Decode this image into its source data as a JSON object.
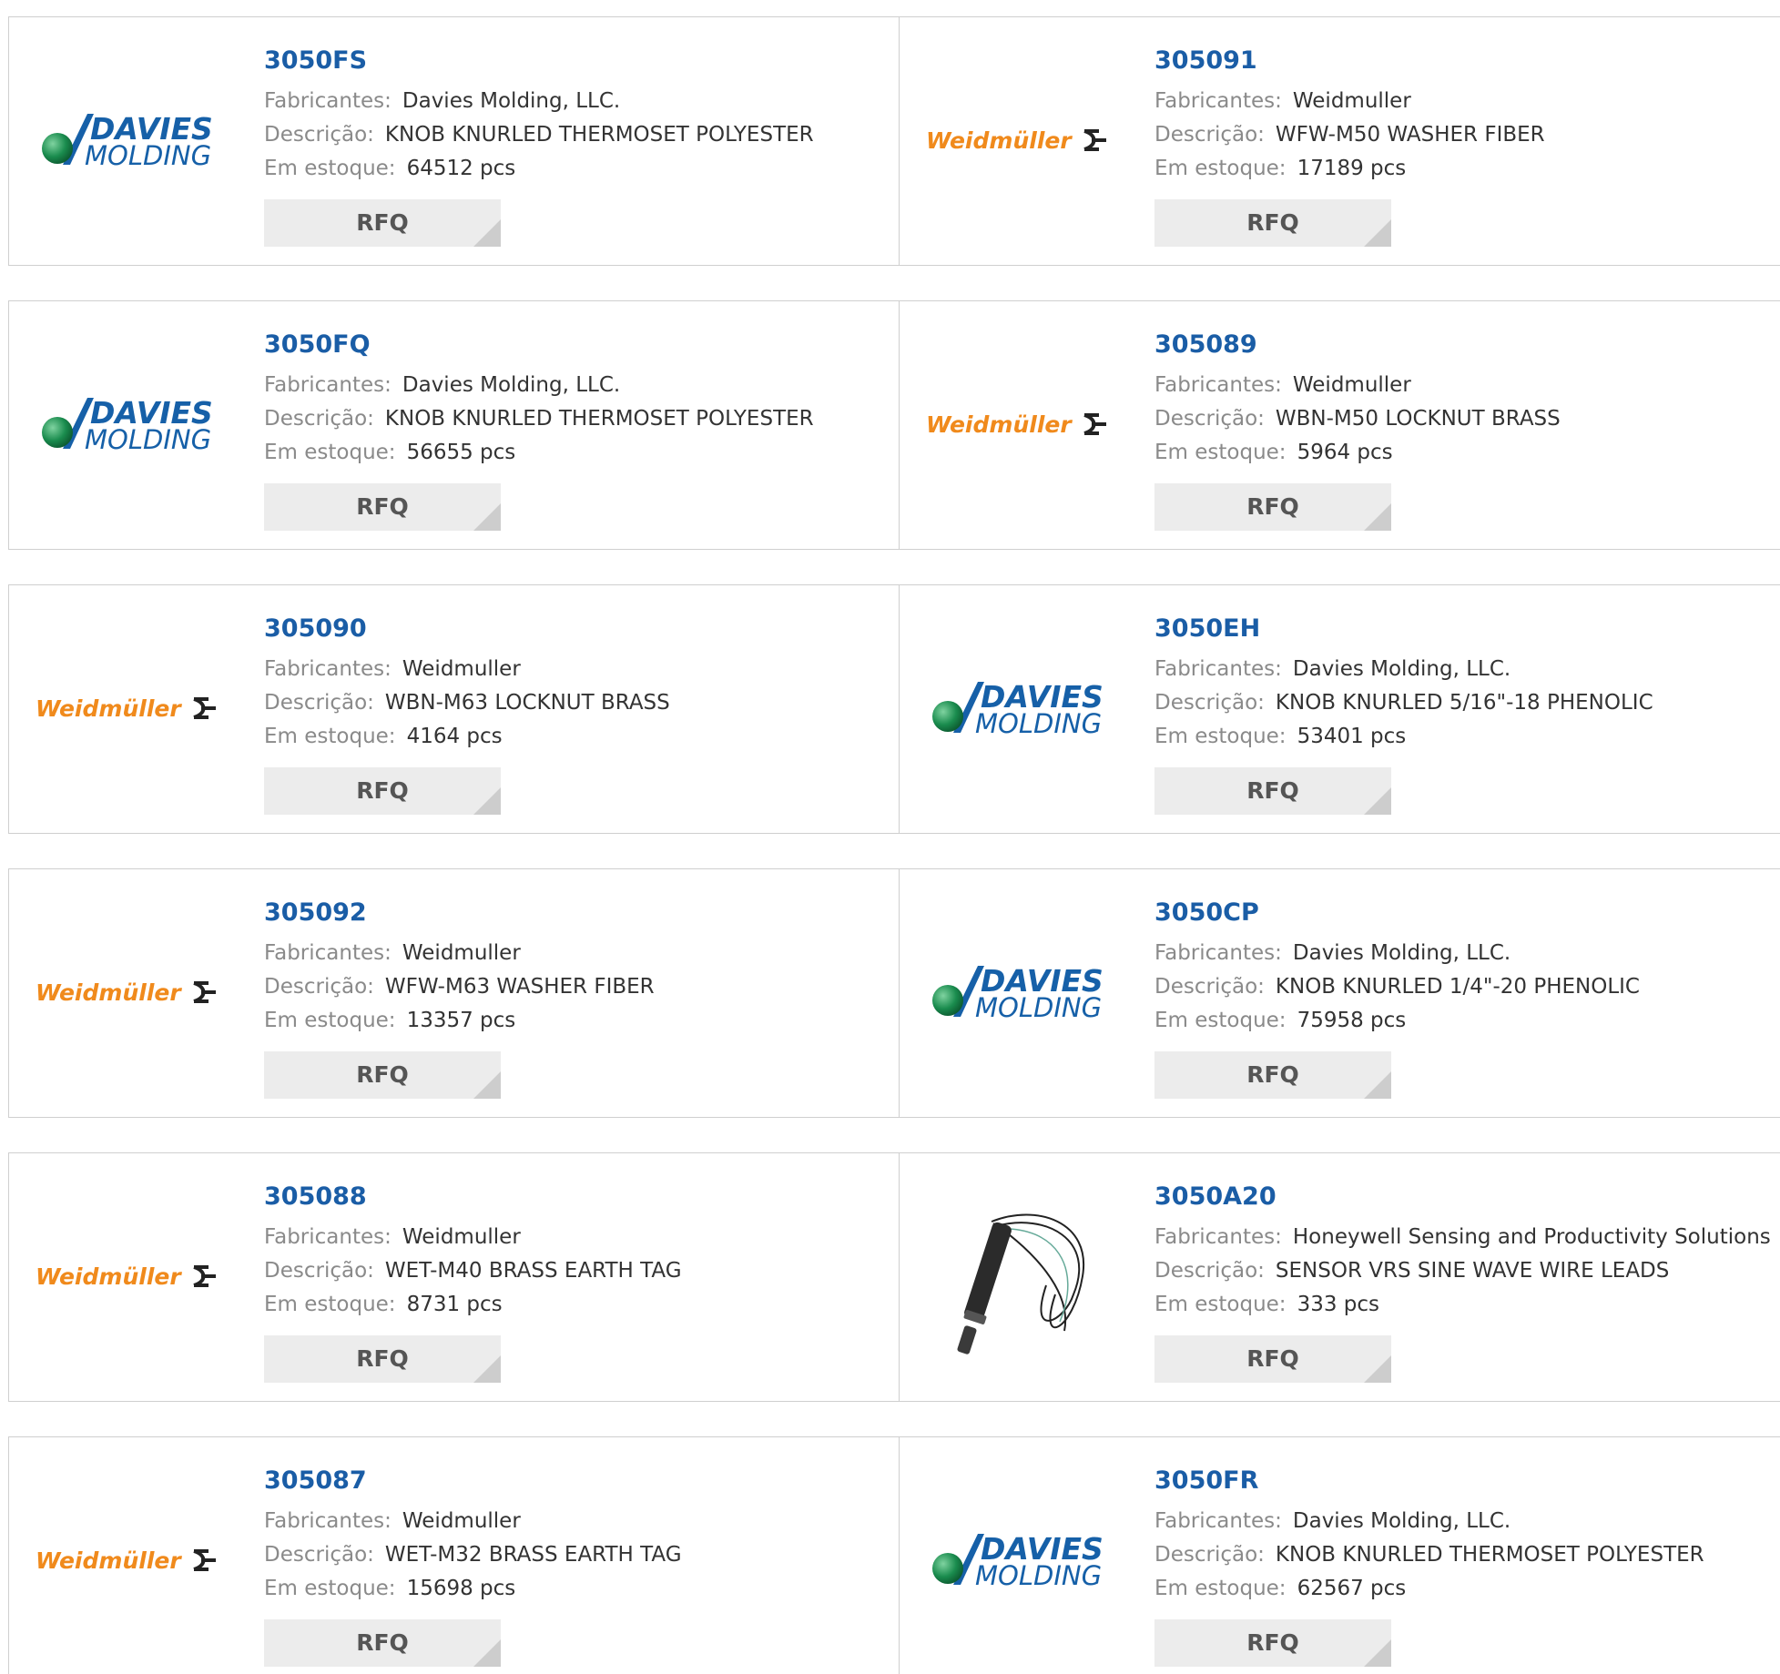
{
  "labels": {
    "manufacturer": "Fabricantes:",
    "description": "Descrição:",
    "stock": "Em estoque:",
    "rfq": "RFQ"
  },
  "logos": {
    "davies": {
      "line1": "DAVIES",
      "line2": "MOLDING"
    },
    "weidmuller": {
      "text": "Weidmüller"
    }
  },
  "colors": {
    "part_link": "#1a5da6",
    "davies_blue": "#1660a8",
    "davies_green": "#1a8c4e",
    "weidmuller_orange": "#f08a1c",
    "label_gray": "#8a8a8a",
    "value_dark": "#333333",
    "button_bg": "#ececec",
    "border": "#cfcfcf"
  },
  "rows": [
    {
      "left": {
        "part": "3050FS",
        "logo": "davies",
        "manufacturer": "Davies Molding, LLC.",
        "description": "KNOB KNURLED THERMOSET POLYESTER",
        "stock": "64512 pcs"
      },
      "right": {
        "part": "305091",
        "logo": "weidmuller",
        "manufacturer": "Weidmuller",
        "description": "WFW-M50 WASHER FIBER",
        "stock": "17189 pcs"
      }
    },
    {
      "left": {
        "part": "3050FQ",
        "logo": "davies",
        "manufacturer": "Davies Molding, LLC.",
        "description": "KNOB KNURLED THERMOSET POLYESTER",
        "stock": "56655 pcs"
      },
      "right": {
        "part": "305089",
        "logo": "weidmuller",
        "manufacturer": "Weidmuller",
        "description": "WBN-M50 LOCKNUT BRASS",
        "stock": "5964 pcs"
      }
    },
    {
      "left": {
        "part": "305090",
        "logo": "weidmuller",
        "manufacturer": "Weidmuller",
        "description": "WBN-M63 LOCKNUT BRASS",
        "stock": "4164 pcs"
      },
      "right": {
        "part": "3050EH",
        "logo": "davies",
        "manufacturer": "Davies Molding, LLC.",
        "description": "KNOB KNURLED 5/16\"-18 PHENOLIC",
        "stock": "53401 pcs"
      }
    },
    {
      "left": {
        "part": "305092",
        "logo": "weidmuller",
        "manufacturer": "Weidmuller",
        "description": "WFW-M63 WASHER FIBER",
        "stock": "13357 pcs"
      },
      "right": {
        "part": "3050CP",
        "logo": "davies",
        "manufacturer": "Davies Molding, LLC.",
        "description": "KNOB KNURLED 1/4\"-20 PHENOLIC",
        "stock": "75958 pcs"
      }
    },
    {
      "left": {
        "part": "305088",
        "logo": "weidmuller",
        "manufacturer": "Weidmuller",
        "description": "WET-M40 BRASS EARTH TAG",
        "stock": "8731 pcs"
      },
      "right": {
        "part": "3050A20",
        "logo": "sensor-photo",
        "manufacturer": "Honeywell Sensing and Productivity Solutions",
        "description": "SENSOR VRS SINE WAVE WIRE LEADS",
        "stock": "333 pcs"
      }
    },
    {
      "left": {
        "part": "305087",
        "logo": "weidmuller",
        "manufacturer": "Weidmuller",
        "description": "WET-M32 BRASS EARTH TAG",
        "stock": "15698 pcs"
      },
      "right": {
        "part": "3050FR",
        "logo": "davies",
        "manufacturer": "Davies Molding, LLC.",
        "description": "KNOB KNURLED THERMOSET POLYESTER",
        "stock": "62567 pcs"
      }
    }
  ]
}
